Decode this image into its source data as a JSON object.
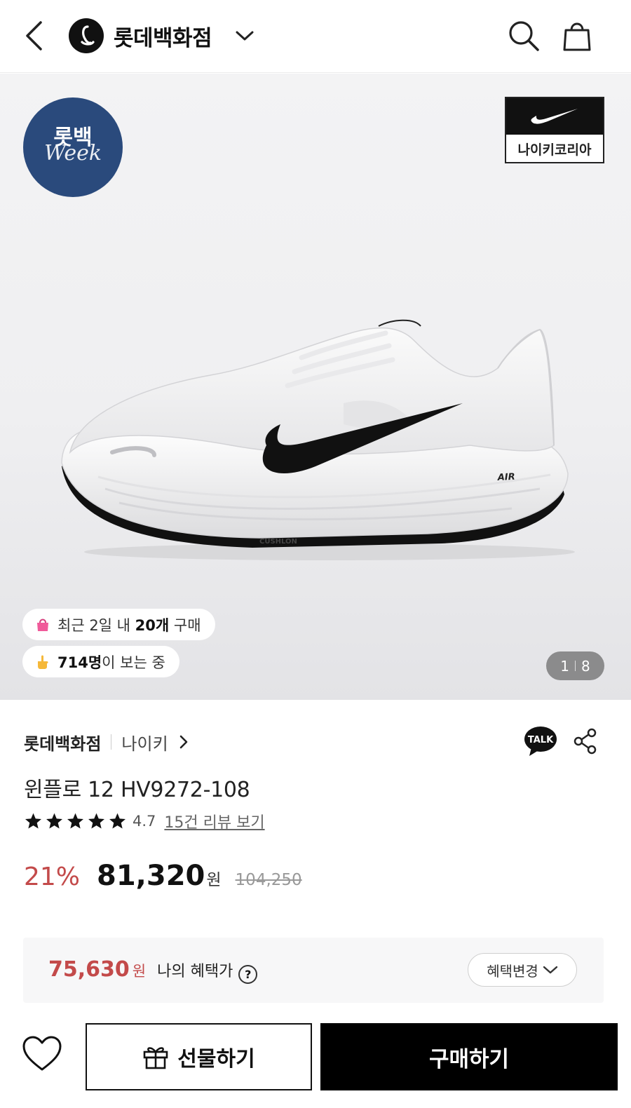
{
  "header": {
    "store_name": "롯데백화점"
  },
  "hero": {
    "week_badge": {
      "korean": "롯백",
      "english": "Week"
    },
    "brand_badge_label": "나이키코리아",
    "stats": {
      "recent_purchase": {
        "prefix": "최근 2일 내 ",
        "count": "20개",
        "suffix": " 구매"
      },
      "viewers": {
        "count": "714명",
        "suffix": "이 보는 중"
      }
    },
    "image_counter": {
      "current": "1",
      "total": "8"
    }
  },
  "product": {
    "store": "롯데백화점",
    "brand": "나이키",
    "name": "윈플로 12 HV9272-108",
    "rating": "4.7",
    "stars_filled": 5,
    "review_link": "15건 리뷰 보기",
    "discount": "21%",
    "price": "81,320",
    "currency": "원",
    "original_price": "104,250"
  },
  "benefit": {
    "price": "75,630",
    "currency": "원",
    "label": "나의 혜택가",
    "help": "?",
    "change_button": "혜택변경"
  },
  "actions": {
    "gift_label": "선물하기",
    "buy_label": "구매하기"
  },
  "colors": {
    "accent_red": "#c34a4a",
    "badge_navy": "#2a4a7c",
    "black": "#000000"
  }
}
